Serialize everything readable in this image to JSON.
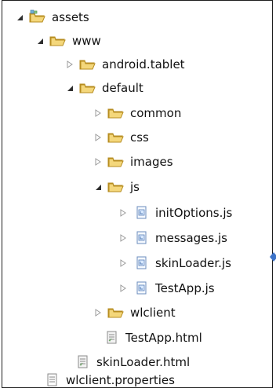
{
  "tree": [
    {
      "label": "assets",
      "icon": "folder-source-icon",
      "state": "expanded"
    },
    {
      "label": "www",
      "icon": "folder-icon",
      "state": "expanded"
    },
    {
      "label": "android.tablet",
      "icon": "folder-icon",
      "state": "collapsed"
    },
    {
      "label": "default",
      "icon": "folder-icon",
      "state": "expanded"
    },
    {
      "label": "common",
      "icon": "folder-icon",
      "state": "collapsed"
    },
    {
      "label": "css",
      "icon": "folder-icon",
      "state": "collapsed"
    },
    {
      "label": "images",
      "icon": "folder-icon",
      "state": "collapsed"
    },
    {
      "label": "js",
      "icon": "folder-icon",
      "state": "expanded"
    },
    {
      "label": "initOptions.js",
      "icon": "js-file-icon",
      "state": "collapsed"
    },
    {
      "label": "messages.js",
      "icon": "js-file-icon",
      "state": "collapsed"
    },
    {
      "label": "skinLoader.js",
      "icon": "js-file-icon",
      "state": "collapsed"
    },
    {
      "label": "TestApp.js",
      "icon": "js-file-icon",
      "state": "collapsed"
    },
    {
      "label": "wlclient",
      "icon": "folder-icon",
      "state": "collapsed"
    },
    {
      "label": "TestApp.html",
      "icon": "html-file-icon",
      "state": "leaf"
    },
    {
      "label": "skinLoader.html",
      "icon": "html-file-icon",
      "state": "leaf"
    },
    {
      "label": "wlclient.properties",
      "icon": "properties-file-icon",
      "state": "leaf"
    }
  ],
  "colors": {
    "folder_fill": "#f4d77b",
    "folder_stroke": "#b78d20",
    "expanded_arrow": "#2e2e2e",
    "collapsed_arrow": "#9b9b9b",
    "marker": "#3d74c9"
  }
}
